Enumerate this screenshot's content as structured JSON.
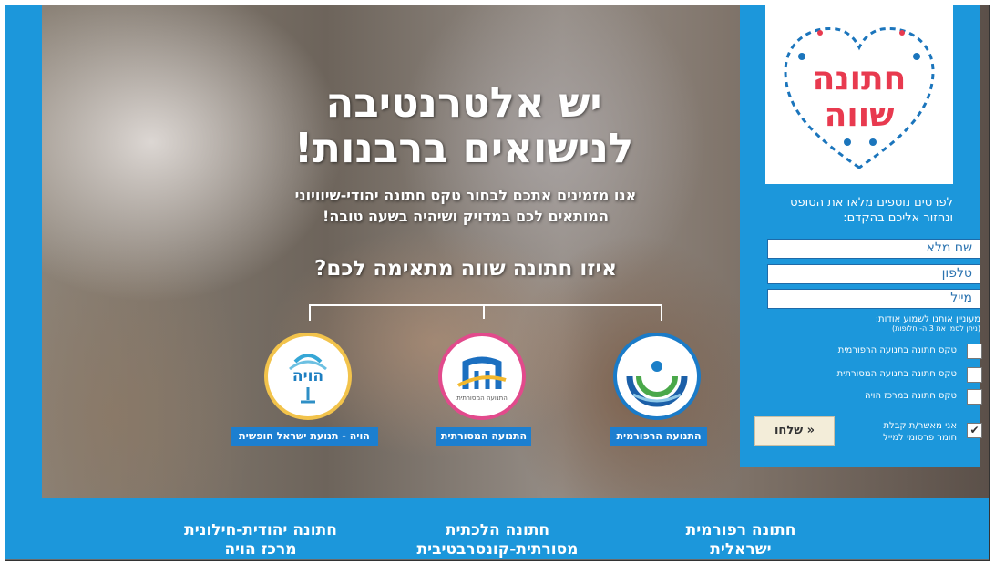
{
  "hero": {
    "title_line1": "יש אלטרנטיבה",
    "title_line2": "לנישואים ברבנות!",
    "subtitle_line1": "אנו מזמינים אתכם לבחור טקס חתונה יהודי-שיוויוני",
    "subtitle_line2": "המותאים לכם במדויק ושיהיה בשעה טובה!",
    "question": "איזו חתונה שווה מתאימה לכם?"
  },
  "movements": [
    {
      "label": "התנועה הרפורמית"
    },
    {
      "label": "התנועה המסורתית",
      "logo_caption": "התנועה המסורתית"
    },
    {
      "label": "הויה - תנועת ישראל חופשית",
      "logo_text": "הויה"
    }
  ],
  "brand": {
    "logo_line1": "חתונה",
    "logo_line2": "שווה",
    "colors": {
      "primary": "#1c97db",
      "logo_red": "#e83a4f",
      "logo_blue": "#1b75bc"
    }
  },
  "form": {
    "intro": "לפרטים נוספים מלאו את הטופס ונחזור אליכם בהקדם:",
    "name_placeholder": "שם מלא",
    "phone_placeholder": "טלפון",
    "email_placeholder": "מייל",
    "interest_label": "מעוניין אותנו לשמוע אודות:",
    "interest_hint": "(ניתן לסמן את 3 ה- חלופות)",
    "options": [
      {
        "label": "טקס חתונה בתנועה הרפורמית",
        "checked": false
      },
      {
        "label": "טקס חתונה בתנועה המסורתית",
        "checked": false
      },
      {
        "label": "טקס חתונה במרכז הויה",
        "checked": false
      }
    ],
    "consent": "אני מאשר/ת קבלת חומר פרסומי למייל",
    "consent_checked": true,
    "consent_mark": "✔",
    "submit": "שלחו »"
  },
  "bottom_links": [
    {
      "line1": "חתונה רפורמית",
      "line2": "ישראלית"
    },
    {
      "line1": "חתונה הלכתית",
      "line2": "מסורתית-קונסרבטיבית"
    },
    {
      "line1": "חתונה יהודית-חילונית",
      "line2": "מרכז הויה"
    }
  ]
}
